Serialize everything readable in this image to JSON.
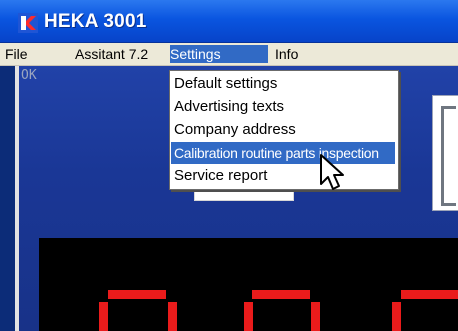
{
  "window": {
    "title": "HEKA 3001",
    "icon": "app-logo-icon"
  },
  "menubar": {
    "items": [
      {
        "label": "File"
      },
      {
        "label": "Assitant 7.2"
      },
      {
        "label": "Settings"
      },
      {
        "label": "Info"
      }
    ]
  },
  "status": {
    "text": "OK"
  },
  "dropdown": {
    "items": [
      {
        "label": "Default settings"
      },
      {
        "label": "Advertising texts"
      },
      {
        "label": "Company address"
      },
      {
        "label": "Calibration routine parts inspection"
      },
      {
        "label": "Service report"
      }
    ]
  },
  "colors": {
    "title_bar": "#0a55e0",
    "menu_highlight": "#316ac5",
    "display_digits": "#ea1b1b"
  }
}
